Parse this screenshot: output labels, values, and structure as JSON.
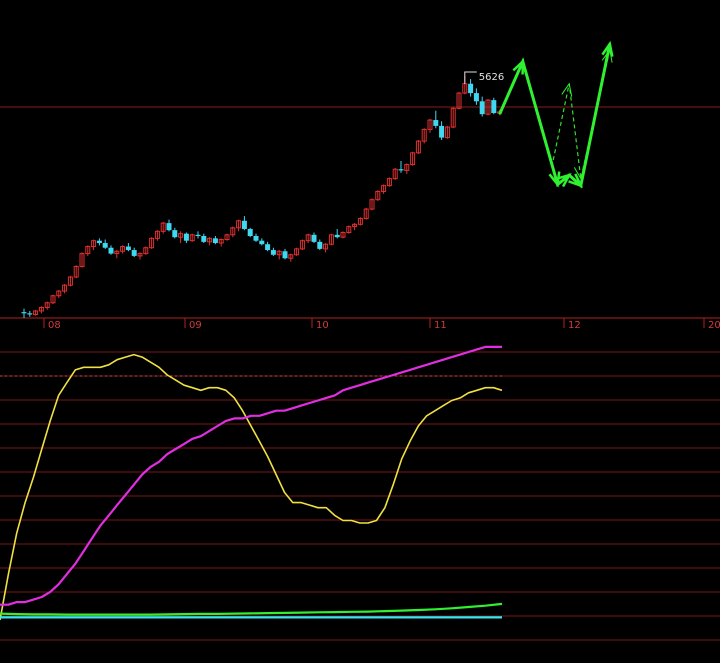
{
  "chart_data": {
    "type": "candlestick",
    "price_panel": {
      "month_ticks": [
        "08",
        "09",
        "10",
        "11",
        "12",
        "20"
      ],
      "high_label": "5626",
      "candles": [
        [
          3610,
          3640,
          3560,
          3600
        ],
        [
          3600,
          3620,
          3570,
          3590
        ],
        [
          3590,
          3630,
          3580,
          3620
        ],
        [
          3620,
          3660,
          3600,
          3650
        ],
        [
          3650,
          3700,
          3630,
          3690
        ],
        [
          3690,
          3760,
          3680,
          3750
        ],
        [
          3750,
          3800,
          3730,
          3790
        ],
        [
          3790,
          3850,
          3770,
          3840
        ],
        [
          3840,
          3920,
          3830,
          3910
        ],
        [
          3910,
          4010,
          3900,
          4000
        ],
        [
          4000,
          4120,
          3990,
          4110
        ],
        [
          4110,
          4180,
          4090,
          4170
        ],
        [
          4170,
          4230,
          4140,
          4220
        ],
        [
          4220,
          4240,
          4180,
          4200
        ],
        [
          4200,
          4230,
          4150,
          4160
        ],
        [
          4160,
          4180,
          4100,
          4110
        ],
        [
          4110,
          4140,
          4070,
          4130
        ],
        [
          4130,
          4180,
          4110,
          4170
        ],
        [
          4170,
          4200,
          4130,
          4140
        ],
        [
          4140,
          4160,
          4080,
          4090
        ],
        [
          4090,
          4120,
          4060,
          4110
        ],
        [
          4110,
          4170,
          4100,
          4160
        ],
        [
          4160,
          4250,
          4150,
          4240
        ],
        [
          4240,
          4310,
          4220,
          4300
        ],
        [
          4300,
          4380,
          4280,
          4370
        ],
        [
          4370,
          4400,
          4300,
          4310
        ],
        [
          4310,
          4330,
          4240,
          4250
        ],
        [
          4250,
          4300,
          4200,
          4280
        ],
        [
          4280,
          4290,
          4200,
          4220
        ],
        [
          4220,
          4280,
          4210,
          4270
        ],
        [
          4270,
          4300,
          4240,
          4260
        ],
        [
          4260,
          4280,
          4200,
          4210
        ],
        [
          4210,
          4250,
          4180,
          4240
        ],
        [
          4240,
          4260,
          4190,
          4200
        ],
        [
          4200,
          4240,
          4170,
          4230
        ],
        [
          4230,
          4280,
          4220,
          4270
        ],
        [
          4270,
          4340,
          4250,
          4330
        ],
        [
          4330,
          4400,
          4300,
          4390
        ],
        [
          4390,
          4430,
          4310,
          4320
        ],
        [
          4320,
          4330,
          4250,
          4260
        ],
        [
          4260,
          4280,
          4210,
          4220
        ],
        [
          4220,
          4240,
          4180,
          4190
        ],
        [
          4190,
          4210,
          4130,
          4140
        ],
        [
          4140,
          4160,
          4090,
          4100
        ],
        [
          4100,
          4140,
          4060,
          4130
        ],
        [
          4130,
          4150,
          4060,
          4070
        ],
        [
          4070,
          4110,
          4040,
          4100
        ],
        [
          4100,
          4160,
          4090,
          4150
        ],
        [
          4150,
          4230,
          4140,
          4220
        ],
        [
          4220,
          4280,
          4200,
          4270
        ],
        [
          4270,
          4290,
          4200,
          4210
        ],
        [
          4210,
          4230,
          4140,
          4150
        ],
        [
          4150,
          4200,
          4120,
          4190
        ],
        [
          4190,
          4280,
          4180,
          4270
        ],
        [
          4270,
          4320,
          4240,
          4250
        ],
        [
          4250,
          4300,
          4240,
          4290
        ],
        [
          4290,
          4350,
          4280,
          4340
        ],
        [
          4340,
          4370,
          4310,
          4360
        ],
        [
          4360,
          4420,
          4350,
          4410
        ],
        [
          4410,
          4500,
          4400,
          4490
        ],
        [
          4490,
          4580,
          4480,
          4570
        ],
        [
          4570,
          4650,
          4560,
          4640
        ],
        [
          4640,
          4700,
          4620,
          4690
        ],
        [
          4690,
          4760,
          4680,
          4750
        ],
        [
          4750,
          4840,
          4740,
          4830
        ],
        [
          4830,
          4900,
          4800,
          4820
        ],
        [
          4820,
          4880,
          4790,
          4870
        ],
        [
          4870,
          4980,
          4860,
          4970
        ],
        [
          4970,
          5080,
          4960,
          5070
        ],
        [
          5070,
          5180,
          5050,
          5170
        ],
        [
          5170,
          5260,
          5140,
          5250
        ],
        [
          5250,
          5330,
          5180,
          5200
        ],
        [
          5200,
          5240,
          5080,
          5100
        ],
        [
          5100,
          5200,
          5090,
          5190
        ],
        [
          5190,
          5360,
          5180,
          5350
        ],
        [
          5350,
          5490,
          5340,
          5480
        ],
        [
          5480,
          5626,
          5470,
          5560
        ],
        [
          5560,
          5600,
          5450,
          5480
        ],
        [
          5480,
          5520,
          5380,
          5410
        ],
        [
          5410,
          5450,
          5280,
          5300
        ],
        [
          5300,
          5430,
          5290,
          5420
        ],
        [
          5420,
          5440,
          5300,
          5310
        ],
        [
          5310,
          5340,
          5290,
          5320
        ]
      ],
      "forecast_solid": [
        [
          82,
          5300
        ],
        [
          86,
          5750
        ],
        [
          92,
          4700
        ],
        [
          94,
          4780
        ],
        [
          96,
          4690
        ],
        [
          101,
          5900
        ]
      ],
      "forecast_dashed": [
        [
          91,
          4850
        ],
        [
          94,
          5560
        ],
        [
          96,
          4750
        ],
        [
          101,
          5850
        ]
      ]
    },
    "indicator_panel": {
      "series": [
        {
          "color": "#f0e040",
          "values": [
            0,
            18,
            34,
            46,
            56,
            67,
            78,
            88,
            93,
            98,
            99,
            99,
            99,
            100,
            102,
            103,
            104,
            103,
            101,
            99,
            96,
            94,
            92,
            91,
            90,
            91,
            91,
            90,
            87,
            82,
            76,
            70,
            64,
            57,
            50,
            46,
            46,
            45,
            44,
            44,
            41,
            39,
            39,
            38,
            38,
            39,
            44,
            53,
            63,
            70,
            76,
            80,
            82,
            84,
            86,
            87,
            89,
            90,
            91,
            91,
            90
          ]
        },
        {
          "color": "#e02ee0",
          "values": [
            6,
            6,
            7,
            7,
            8,
            9,
            11,
            14,
            18,
            22,
            27,
            32,
            37,
            41,
            45,
            49,
            53,
            57,
            60,
            62,
            65,
            67,
            69,
            71,
            72,
            74,
            76,
            78,
            79,
            79,
            80,
            80,
            81,
            82,
            82,
            83,
            84,
            85,
            86,
            87,
            88,
            90,
            91,
            92,
            93,
            94,
            95,
            96,
            97,
            98,
            99,
            100,
            101,
            102,
            103,
            104,
            105,
            106,
            107,
            107,
            107
          ]
        },
        {
          "color": "#30f030",
          "values": [
            2.5,
            2.3,
            2.2,
            2.2,
            2.1,
            2.1,
            2.1,
            2.1,
            2.1,
            2.1,
            2.2,
            2.3,
            2.4,
            2.4,
            2.5,
            2.6,
            2.7,
            2.8,
            2.9,
            3.0,
            3.1,
            3.2,
            3.3,
            3.5,
            3.7,
            3.9,
            4.2,
            4.6,
            5.1,
            5.6,
            6.3
          ]
        },
        {
          "color": "#30e8f0",
          "values": [
            1,
            1,
            1,
            1,
            1,
            1,
            1,
            1,
            1,
            1,
            1,
            1,
            1,
            1,
            1,
            1,
            1,
            1,
            1,
            1,
            1,
            1,
            1,
            1,
            1,
            1,
            1,
            1,
            1,
            1,
            1
          ]
        }
      ]
    }
  }
}
